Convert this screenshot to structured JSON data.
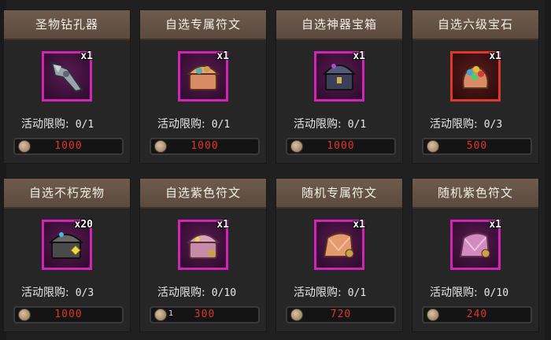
{
  "limit_label": "活动限购:",
  "items": [
    {
      "title": "圣物钻孔器",
      "qty": "x1",
      "limit": "0/1",
      "price": "1000",
      "border": "magenta",
      "icon": "drill-icon"
    },
    {
      "title": "自选专属符文",
      "qty": "x1",
      "limit": "0/1",
      "price": "1000",
      "border": "magenta",
      "icon": "rune-chest-icon"
    },
    {
      "title": "自选神器宝箱",
      "qty": "x1",
      "limit": "0/1",
      "price": "1000",
      "border": "magenta",
      "icon": "artifact-chest-icon"
    },
    {
      "title": "自选六级宝石",
      "qty": "x1",
      "limit": "0/3",
      "price": "500",
      "border": "red",
      "icon": "gem-bag-icon"
    },
    {
      "title": "自选不朽宠物",
      "qty": "x20",
      "limit": "0/3",
      "price": "1000",
      "border": "magenta",
      "icon": "pet-chest-icon"
    },
    {
      "title": "自选紫色符文",
      "qty": "x1",
      "limit": "0/10",
      "price": "300",
      "price_note": "1",
      "border": "magenta",
      "icon": "purple-rune-chest-icon"
    },
    {
      "title": "随机专属符文",
      "qty": "x1",
      "limit": "0/1",
      "price": "720",
      "border": "magenta",
      "icon": "random-rune-pouch-icon"
    },
    {
      "title": "随机紫色符文",
      "qty": "x1",
      "limit": "0/10",
      "price": "240",
      "border": "magenta",
      "icon": "random-purple-rune-pouch-icon"
    }
  ],
  "colors": {
    "price": "#e0352a",
    "magenta_border": "#d222b8",
    "red_border": "#e0372c",
    "title_bg": "#6e5b4d"
  }
}
